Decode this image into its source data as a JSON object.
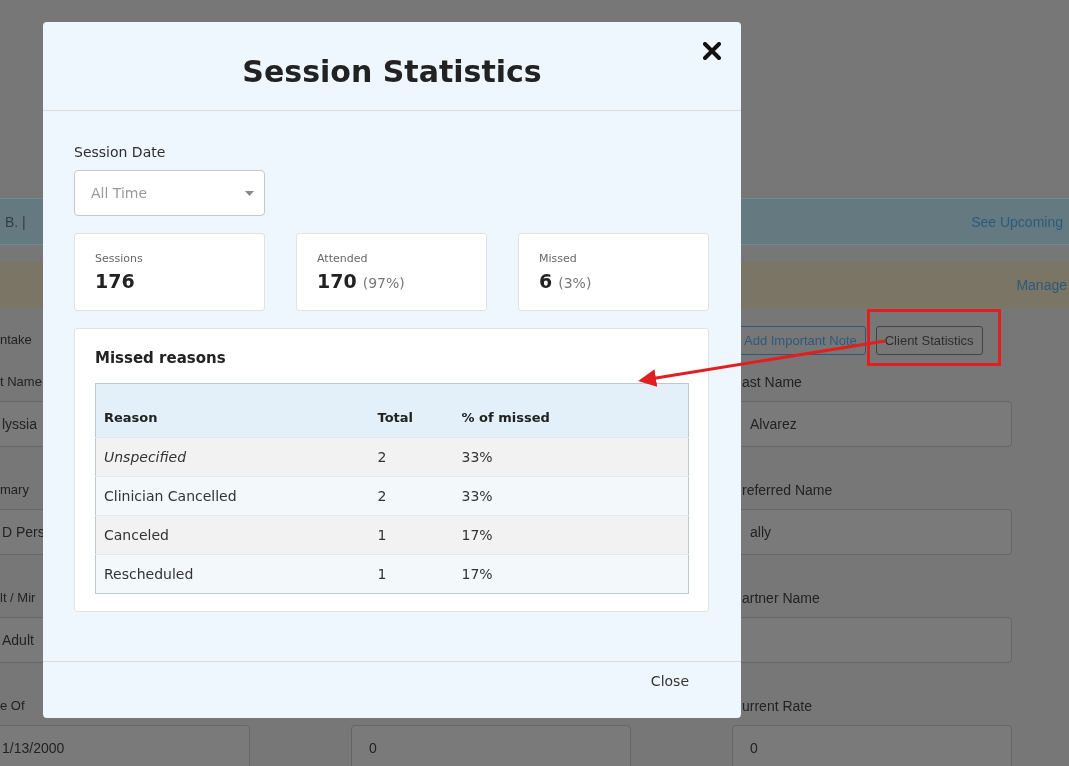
{
  "page": {
    "banner": {
      "text": "B. |",
      "link": "See Upcoming"
    },
    "notice": {
      "link": "Manage"
    },
    "intake_label": "ntake",
    "buttons": [
      {
        "label": "Add Important Note",
        "highlighted": false
      },
      {
        "label": "Client Statistics",
        "highlighted": true
      }
    ],
    "left_fields": [
      {
        "label": "t Name",
        "value": "lyssia"
      },
      {
        "label": "mary",
        "value": "D Pers"
      },
      {
        "label": "lt / Mir",
        "value": "Adult"
      },
      {
        "label": "e Of",
        "value": "1/13/2000"
      }
    ],
    "middle_field": {
      "value": "0"
    },
    "right_fields": [
      {
        "label": "ast Name",
        "value": "Alvarez"
      },
      {
        "label": "referred Name",
        "value": "ally"
      },
      {
        "label": "artner Name"
      },
      {
        "label": "urrent Rate",
        "value": "0"
      }
    ]
  },
  "dialog": {
    "title": "Session Statistics",
    "date_filter": {
      "label": "Session Date",
      "placeholder": "All Time"
    },
    "stats": [
      {
        "label": "Sessions",
        "value": "176"
      },
      {
        "label": "Attended",
        "value": "170",
        "percent": "(97%)"
      },
      {
        "label": "Missed",
        "value": "6",
        "percent": "(3%)"
      }
    ],
    "missed_reasons": {
      "title": "Missed reasons",
      "columns": [
        "Reason",
        "Total",
        "% of missed"
      ],
      "rows": [
        {
          "reason": "Unspecified",
          "unspecified": true,
          "total": "2",
          "percent": "33%"
        },
        {
          "reason": "Clinician Cancelled",
          "unspecified": false,
          "total": "2",
          "percent": "33%"
        },
        {
          "reason": "Canceled",
          "unspecified": false,
          "total": "1",
          "percent": "17%"
        },
        {
          "reason": "Rescheduled",
          "unspecified": false,
          "total": "1",
          "percent": "17%"
        }
      ]
    },
    "close_button": "Close"
  }
}
